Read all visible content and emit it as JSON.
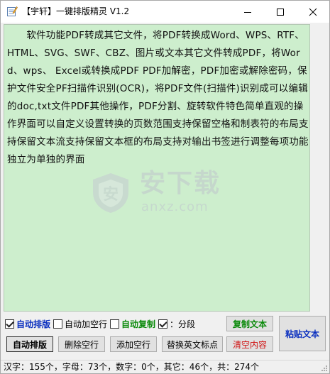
{
  "window": {
    "title": "【宇轩】一键排版精灵 V1.2"
  },
  "editor": {
    "content": "　　软件功能PDF转成其它文件，将PDF转换成Word、WPS、RTF、HTML、SVG、SWF、CBZ、图片或文本其它文件转成PDF，将Word、wps、 Excel或转换成PDF PDF加解密，PDF加密或解除密码，保护文件安全PF扫描件识别(OCR)，将PDF文件(扫描件)识别成可以编辑的doc,txt文件PDF其他操作，PDF分割、旋转软件特色简单直观的操作界面可以自定义设置转换的页数范围支持保留空格和制表符的布局支持保留文本流支持保留文本框的布局支持对输出书签进行调整每项功能独立为单独的界面"
  },
  "watermark": {
    "brand": "安下载",
    "domain": "anxz.com"
  },
  "options": {
    "auto_format": {
      "label": "自动排版",
      "checked": true
    },
    "auto_blank_line": {
      "label": "自动加空行",
      "checked": false
    },
    "auto_copy": {
      "label": "自动复制",
      "checked": false
    },
    "paragraph": {
      "label": "：分段",
      "checked": true
    }
  },
  "buttons": {
    "copy_text": "复制文本",
    "paste_text": "粘贴文本",
    "auto_format": "自动排版",
    "delete_blank_lines": "删除空行",
    "add_blank_lines": "添加空行",
    "replace_punct": "替换英文标点",
    "clear_content": "清空内容"
  },
  "colors": {
    "editor_bg": "#cdeecd",
    "copy_text": "#0a8a0a",
    "paste_text": "#0a2fbf",
    "clear_content": "#d01010"
  },
  "status": {
    "text": "汉字：155个，字母：73个，数字：0个，其它：46个，共：274个"
  }
}
